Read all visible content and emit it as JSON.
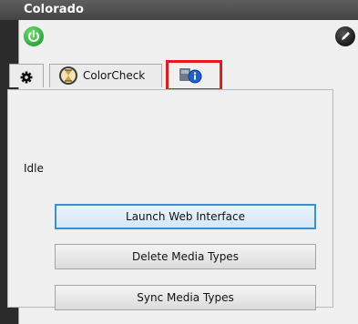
{
  "window": {
    "title": "Colorado"
  },
  "toolbar": {
    "power_icon": "power-icon",
    "edit_icon": "pencil-icon"
  },
  "tabs": [
    {
      "label": "",
      "icon": "gear-icon"
    },
    {
      "label": "ColorCheck",
      "icon": "hourglass-icon"
    },
    {
      "label": "",
      "icon": "info-icon"
    }
  ],
  "main": {
    "status": "Idle",
    "buttons": {
      "launch": "Launch Web Interface",
      "delete": "Delete Media Types",
      "sync": "Sync Media Types"
    }
  },
  "colors": {
    "highlight": "#e8191f",
    "power": "#2fa83a",
    "focus_border": "#3b8fd6"
  }
}
